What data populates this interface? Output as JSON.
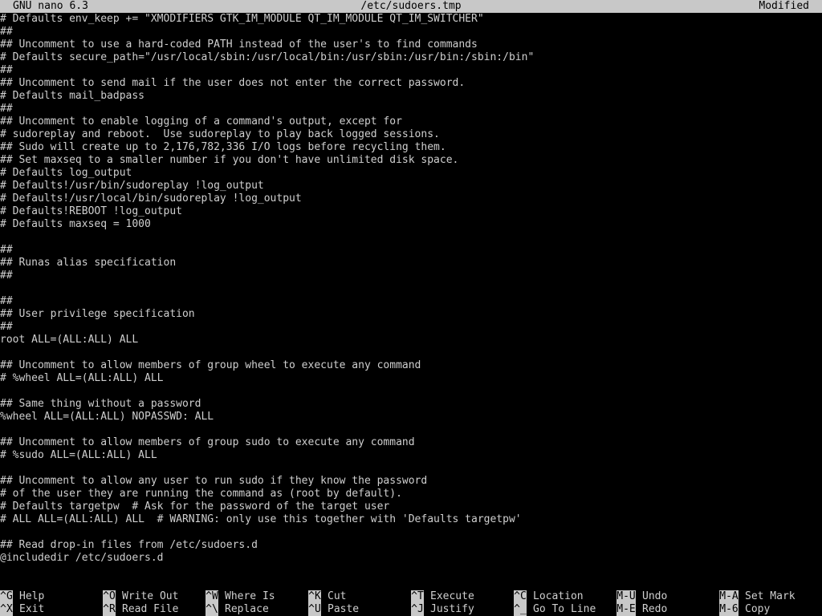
{
  "titlebar": {
    "app": "GNU nano 6.3",
    "file": "/etc/sudoers.tmp",
    "status": "Modified"
  },
  "editor": {
    "lines": [
      "# Defaults env_keep += \"XMODIFIERS GTK_IM_MODULE QT_IM_MODULE QT_IM_SWITCHER\"",
      "##",
      "## Uncomment to use a hard-coded PATH instead of the user's to find commands",
      "# Defaults secure_path=\"/usr/local/sbin:/usr/local/bin:/usr/sbin:/usr/bin:/sbin:/bin\"",
      "##",
      "## Uncomment to send mail if the user does not enter the correct password.",
      "# Defaults mail_badpass",
      "##",
      "## Uncomment to enable logging of a command's output, except for",
      "# sudoreplay and reboot.  Use sudoreplay to play back logged sessions.",
      "## Sudo will create up to 2,176,782,336 I/O logs before recycling them.",
      "## Set maxseq to a smaller number if you don't have unlimited disk space.",
      "# Defaults log_output",
      "# Defaults!/usr/bin/sudoreplay !log_output",
      "# Defaults!/usr/local/bin/sudoreplay !log_output",
      "# Defaults!REBOOT !log_output",
      "# Defaults maxseq = 1000",
      "",
      "##",
      "## Runas alias specification",
      "##",
      "",
      "##",
      "## User privilege specification",
      "##",
      "root ALL=(ALL:ALL) ALL",
      "",
      "## Uncomment to allow members of group wheel to execute any command",
      "# %wheel ALL=(ALL:ALL) ALL",
      "",
      "## Same thing without a password",
      "%wheel ALL=(ALL:ALL) NOPASSWD: ALL",
      "",
      "## Uncomment to allow members of group sudo to execute any command",
      "# %sudo ALL=(ALL:ALL) ALL",
      "",
      "## Uncomment to allow any user to run sudo if they know the password",
      "# of the user they are running the command as (root by default).",
      "# Defaults targetpw  # Ask for the password of the target user",
      "# ALL ALL=(ALL:ALL) ALL  # WARNING: only use this together with 'Defaults targetpw'",
      "",
      "## Read drop-in files from /etc/sudoers.d",
      "@includedir /etc/sudoers.d"
    ]
  },
  "shortcuts": [
    {
      "key": "^G",
      "label": "Help"
    },
    {
      "key": "^X",
      "label": "Exit"
    },
    {
      "key": "^O",
      "label": "Write Out"
    },
    {
      "key": "^R",
      "label": "Read File"
    },
    {
      "key": "^W",
      "label": "Where Is"
    },
    {
      "key": "^\\",
      "label": "Replace"
    },
    {
      "key": "^K",
      "label": "Cut"
    },
    {
      "key": "^U",
      "label": "Paste"
    },
    {
      "key": "^T",
      "label": "Execute"
    },
    {
      "key": "^J",
      "label": "Justify"
    },
    {
      "key": "^C",
      "label": "Location"
    },
    {
      "key": "^_",
      "label": "Go To Line"
    },
    {
      "key": "M-U",
      "label": "Undo"
    },
    {
      "key": "M-E",
      "label": "Redo"
    },
    {
      "key": "M-A",
      "label": "Set Mark"
    },
    {
      "key": "M-6",
      "label": "Copy"
    }
  ]
}
